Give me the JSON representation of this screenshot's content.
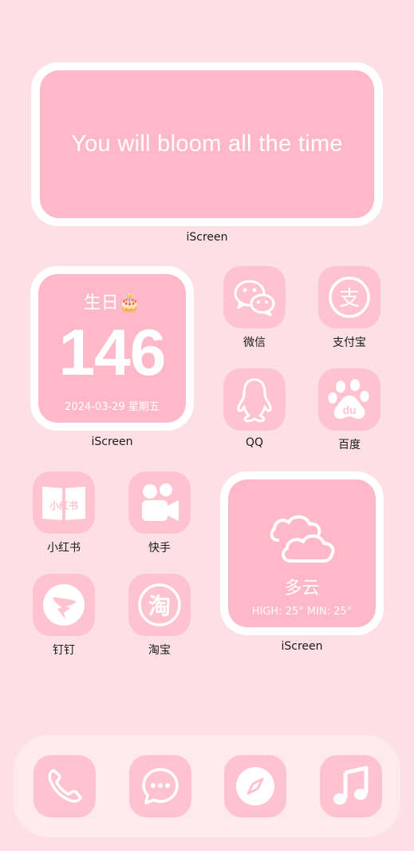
{
  "quote_widget": {
    "text": "You will bloom all the time",
    "caption": "iScreen"
  },
  "birthday_widget": {
    "title": "生日🎂",
    "days": "146",
    "date": "2024-03-29 星期五",
    "caption": "iScreen"
  },
  "weather_widget": {
    "condition": "多云",
    "temps": "HIGH: 25° MIN: 25°",
    "caption": "iScreen"
  },
  "apps": {
    "wechat": "微信",
    "alipay": "支付宝",
    "qq": "QQ",
    "baidu": "百度",
    "xiaohongshu": "小红书",
    "xiaohongshu_logo": "小红书",
    "kuaishou": "快手",
    "dingtalk": "钉钉",
    "taobao": "淘宝",
    "taobao_logo": "淘",
    "alipay_logo": "支",
    "baidu_logo": "du"
  },
  "dock": {
    "icons": [
      "phone-icon",
      "messages-icon",
      "compass-icon",
      "music-icon"
    ]
  },
  "colors": {
    "background": "#fde0e6",
    "widget_fill": "#ffb8c7",
    "icon_fill": "#ffc3cf",
    "dock": "#fdeaee",
    "frame": "#ffffff"
  }
}
